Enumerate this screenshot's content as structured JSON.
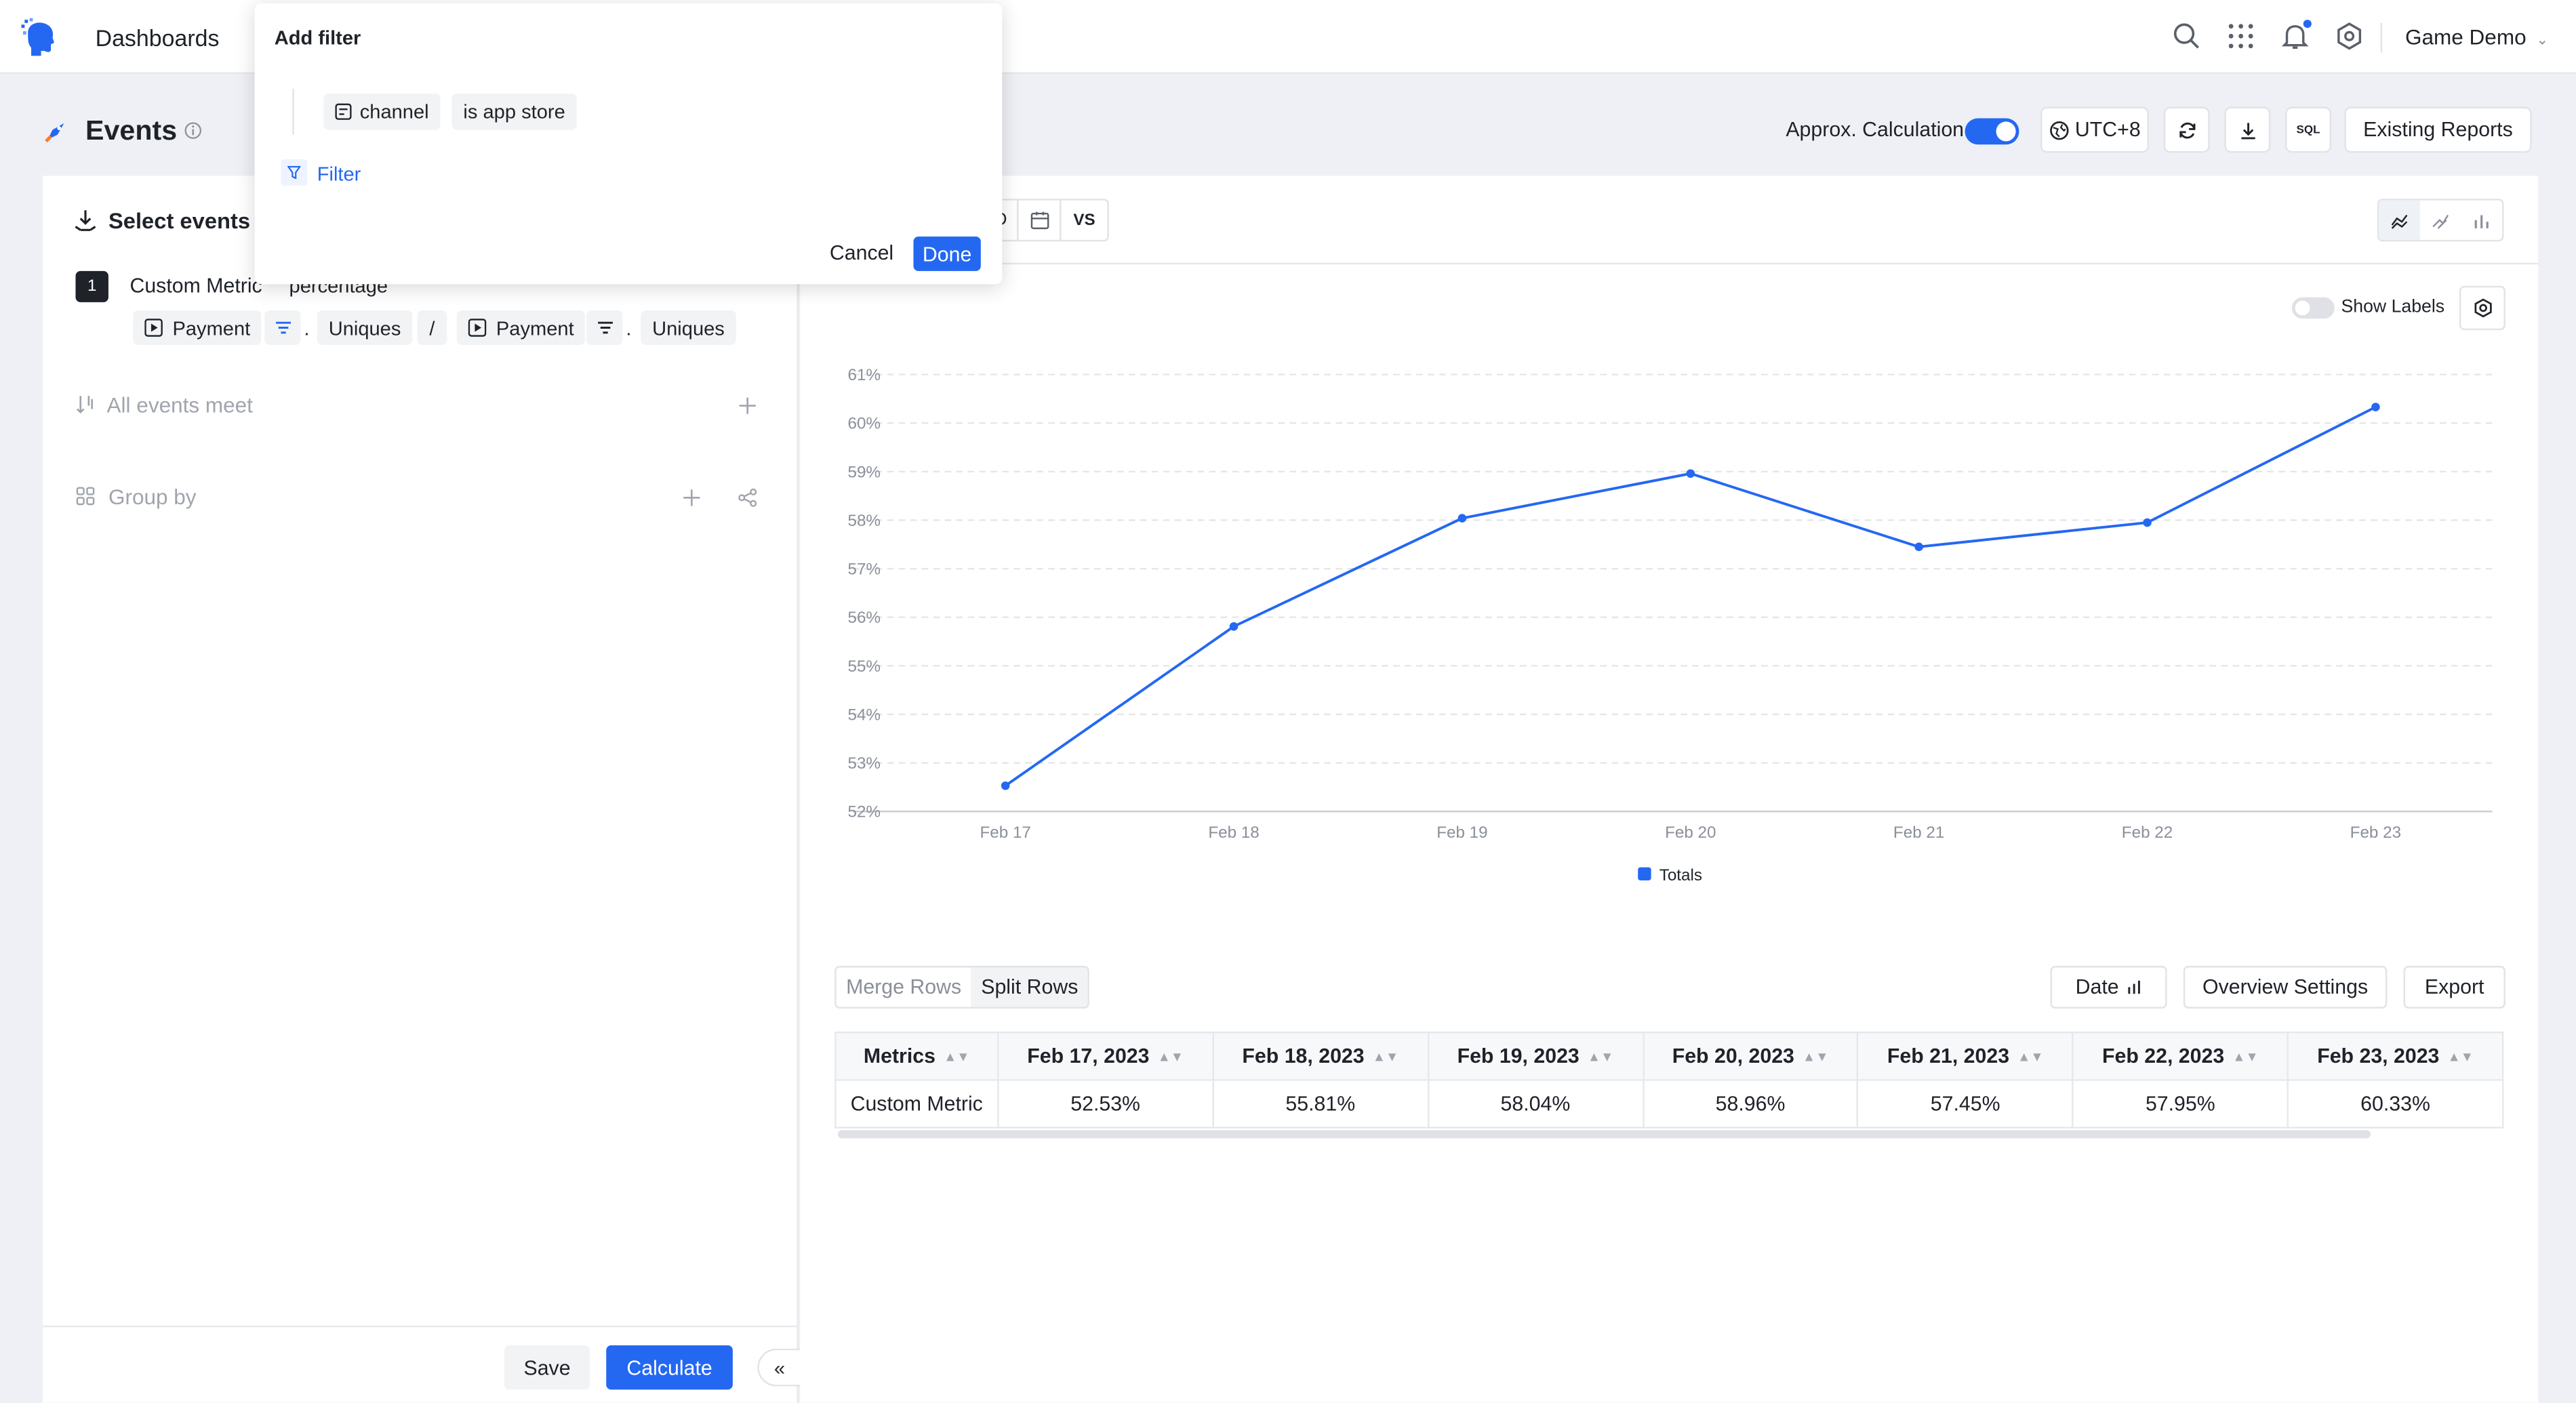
{
  "topbar": {
    "title": "Dashboards",
    "workspace": "Game Demo"
  },
  "page": {
    "title": "Events",
    "approx_label": "Approx. Calculation",
    "approx_enabled": true,
    "timezone": "UTC+8",
    "sql_label": "SQL",
    "existing_reports": "Existing Reports"
  },
  "left": {
    "select_events_title": "Select events",
    "metric_index": "1",
    "metric_name": "Custom Metric",
    "metric_format": "percentage",
    "numerator_event": "Payment",
    "numerator_agg": "Uniques",
    "divide_symbol": "/",
    "denominator_event": "Payment",
    "denominator_agg": "Uniques",
    "dot": ".",
    "all_events_meet": "All events meet",
    "group_by": "Group by",
    "save": "Save",
    "calculate": "Calculate",
    "collapse": "«"
  },
  "popover": {
    "title": "Add filter",
    "property": "channel",
    "condition": "is app store",
    "filter_link": "Filter",
    "cancel": "Cancel",
    "done": "Done"
  },
  "toolbar": {
    "date_partial": "D",
    "compare": "VS",
    "show_labels": "Show Labels"
  },
  "chart_data": {
    "type": "line",
    "categories": [
      "Feb 17",
      "Feb 18",
      "Feb 19",
      "Feb 20",
      "Feb 21",
      "Feb 22",
      "Feb 23"
    ],
    "series": [
      {
        "name": "Totals",
        "values": [
          52.53,
          55.81,
          58.04,
          58.96,
          57.45,
          57.95,
          60.33
        ]
      }
    ],
    "yticks": [
      "52%",
      "53%",
      "54%",
      "55%",
      "56%",
      "57%",
      "58%",
      "59%",
      "60%",
      "61%"
    ],
    "ylim": [
      52,
      61
    ],
    "grid": true,
    "legend_position": "bottom",
    "color": "#2468f2"
  },
  "table": {
    "merge_rows": "Merge Rows",
    "split_rows": "Split Rows",
    "date_btn": "Date",
    "overview_settings": "Overview Settings",
    "export": "Export",
    "headers": [
      "Metrics",
      "Feb 17, 2023",
      "Feb 18, 2023",
      "Feb 19, 2023",
      "Feb 20, 2023",
      "Feb 21, 2023",
      "Feb 22, 2023",
      "Feb 23, 2023"
    ],
    "rows": [
      [
        "Custom Metric",
        "52.53%",
        "55.81%",
        "58.04%",
        "58.96%",
        "57.45%",
        "57.95%",
        "60.33%"
      ]
    ]
  },
  "colors": {
    "accent": "#2468f2",
    "text": "#1f2329",
    "muted": "#a0a4ad",
    "page_bg": "#eef0f5"
  }
}
